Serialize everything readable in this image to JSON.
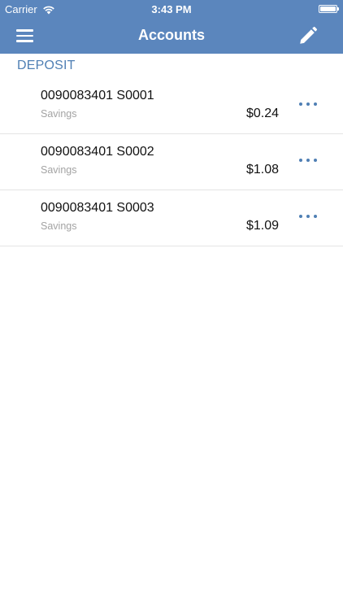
{
  "status_bar": {
    "carrier": "Carrier",
    "time": "3:43 PM"
  },
  "navbar": {
    "title": "Accounts",
    "menu_icon": "hamburger-menu-icon",
    "edit_icon": "pencil-icon"
  },
  "section": {
    "title": "DEPOSIT"
  },
  "accounts": [
    {
      "number": "0090083401 S0001",
      "type": "Savings",
      "balance": "$0.24"
    },
    {
      "number": "0090083401 S0002",
      "type": "Savings",
      "balance": "$1.08"
    },
    {
      "number": "0090083401 S0003",
      "type": "Savings",
      "balance": "$1.09"
    }
  ],
  "colors": {
    "header_bg": "#5b86bd",
    "accent": "#4f7fb4",
    "secondary_text": "#a3a3a3",
    "divider": "#e4e4e4"
  }
}
